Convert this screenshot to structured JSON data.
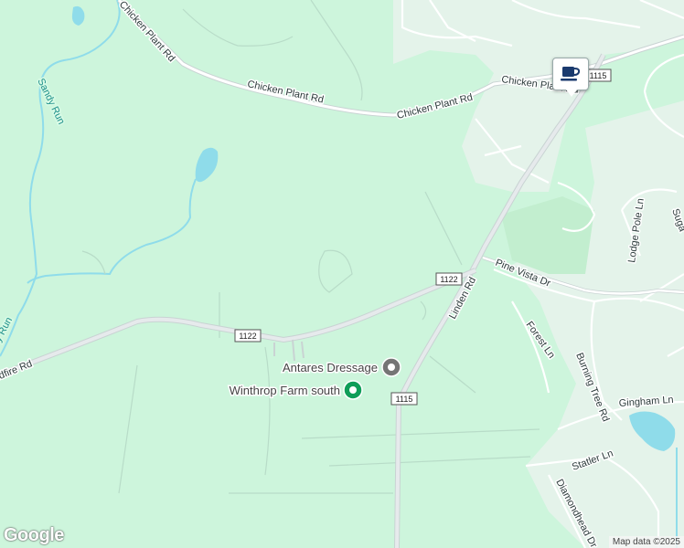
{
  "map": {
    "colors": {
      "land": "#cdf5dc",
      "residential": "#e4f3ea",
      "water": "#8fdcea",
      "road": "#ffffff",
      "road_casing": "#c9d3d3",
      "major_road": "#d9dde0",
      "poi_green": "#0f9d58",
      "poi_gray": "#757575"
    },
    "roads": {
      "chicken_plant_rd_1": "Chicken Plant Rd",
      "chicken_plant_rd_2": "Chicken Plant Rd",
      "chicken_plant_rd_3": "Chicken Plant Rd",
      "chicken_plant_rd_4": "Chicken Plant Rd",
      "linden_rd": "Linden Rd",
      "pine_vista_dr": "Pine Vista Dr",
      "forest_ln": "Forest Ln",
      "burning_tree_rd": "Burning Tree Rd",
      "gingham_ln": "Gingham Ln",
      "statler_ln": "Statler Ln",
      "diamondhead_dr": "Diamondhead Dr",
      "lodge_pole_ln": "Lodge Pole Ln",
      "sugar": "Suga",
      "wildfire_rd": "ldfire Rd"
    },
    "water": {
      "sandy_run_1": "Sandy Run",
      "sandy_run_2": "y Run"
    },
    "shields": {
      "route_1122_a": "1122",
      "route_1122_b": "1122",
      "route_1115_a": "1115",
      "route_1115_b": "1115"
    },
    "pois": {
      "antares": "Antares Dressage",
      "winthrop": "Winthrop Farm south"
    },
    "marker": {
      "icon": "coffee-cup-icon"
    }
  },
  "footer": {
    "logo": "Google",
    "attribution": "Map data ©2025"
  }
}
